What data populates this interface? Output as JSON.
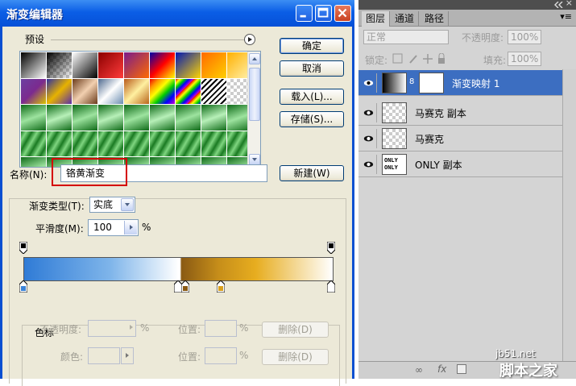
{
  "dialog": {
    "title": "渐变编辑器",
    "presets_label": "预设",
    "buttons": {
      "ok": "确定",
      "cancel": "取消",
      "load": "载入(L)...",
      "save": "存储(S)...",
      "new": "新建(W)"
    },
    "name_label": "名称(N):",
    "name_value": "铬黄渐变",
    "gradient_type_label": "渐变类型(T):",
    "gradient_type_value": "实底",
    "smoothness_label": "平滑度(M):",
    "smoothness_value": "100",
    "smoothness_unit": "%",
    "stops_group_label": "色标",
    "opacity_label": "不透明度:",
    "opacity_unit": "%",
    "location_label": "位置:",
    "location_unit": "%",
    "color_label": "颜色:",
    "delete_label": "删除(D)",
    "gradient_colors": [
      "#2f7bd6",
      "#7fb5ea",
      "#ffffff",
      "#8a5a13",
      "#c68e1a",
      "#e7ad1f",
      "#ffffff"
    ]
  },
  "layers_panel": {
    "tabs": [
      "图层",
      "通道",
      "路径"
    ],
    "blend_mode": "正常",
    "opacity_label": "不透明度:",
    "opacity_value": "100%",
    "lock_label": "锁定:",
    "fill_label": "填充:",
    "fill_value": "100%",
    "layers": [
      {
        "name": "渐变映射 1",
        "selected": true
      },
      {
        "name": "马赛克 副本",
        "selected": false
      },
      {
        "name": "马赛克",
        "selected": false
      },
      {
        "name": "ONLY 副本",
        "selected": false
      }
    ],
    "layer_thumb_text": "ONLY ONLY"
  },
  "watermark": {
    "site": "jb51.net",
    "brand": "脚本之家"
  }
}
